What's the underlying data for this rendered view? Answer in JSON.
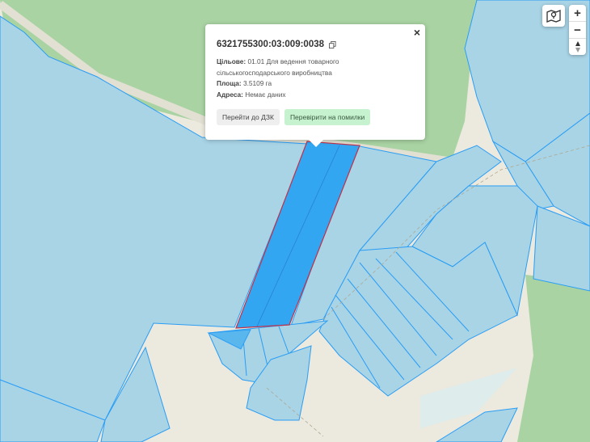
{
  "popup": {
    "cadastral_number": "6321755300:03:009:0038",
    "purpose_label": "Цільове:",
    "purpose_value": "01.01 Для ведення товарного сільськогосподарського виробництва",
    "area_label": "Площа:",
    "area_value": "3.5109 га",
    "address_label": "Адреса:",
    "address_value": "Немає даних",
    "btn_dzk": "Перейти до ДЗК",
    "btn_check": "Перевірити на помилки",
    "close_symbol": "×"
  },
  "controls": {
    "zoom_in": "+",
    "zoom_out": "−",
    "layers_icon": "map-layers-icon",
    "compass_icon": "compass-icon"
  },
  "colors": {
    "water_parcel": "#a8d4e6",
    "parcel_outline": "#2a9df4",
    "selected_parcel": "#33a6f2",
    "selected_outline": "#c0304a",
    "forest": "#a9d3a3",
    "land": "#ece9de"
  }
}
